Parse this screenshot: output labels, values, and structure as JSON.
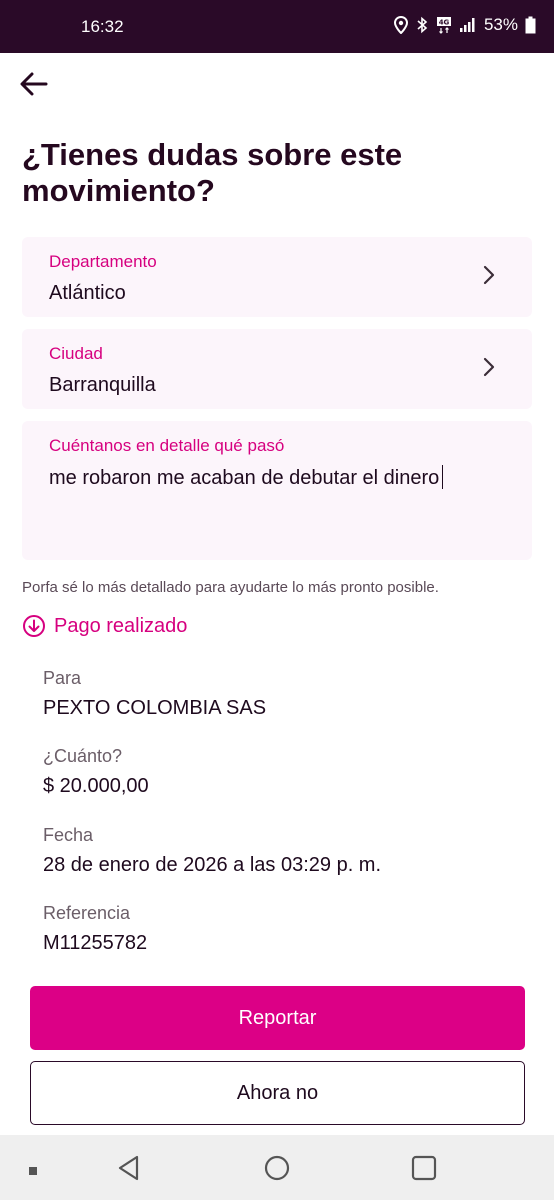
{
  "status_bar": {
    "time": "16:32",
    "battery": "53%",
    "icons": [
      "location-icon",
      "bluetooth-icon",
      "network-4g-icon",
      "signal-icon",
      "battery-icon"
    ]
  },
  "header": {
    "back_icon": "arrow-left-icon",
    "title": "¿Tienes dudas sobre este movimiento?"
  },
  "form": {
    "departamento": {
      "label": "Departamento",
      "value": "Atlántico"
    },
    "ciudad": {
      "label": "Ciudad",
      "value": "Barranquilla"
    },
    "detalle": {
      "label": "Cuéntanos en detalle qué pasó",
      "value": "me robaron me acaban de debutar el dinero"
    },
    "hint": "Porfa sé lo más detallado para ayudarte lo más pronto posible."
  },
  "pago": {
    "toggle_label": "Pago realizado",
    "para": {
      "label": "Para",
      "value": "PEXTO COLOMBIA SAS"
    },
    "cuanto": {
      "label": "¿Cuánto?",
      "value": "$ 20.000,00"
    },
    "fecha": {
      "label": "Fecha",
      "value": "28 de enero de 2026 a las 03:29 p. m."
    },
    "referencia": {
      "label": "Referencia",
      "value": "M11255782"
    }
  },
  "actions": {
    "primary": "Reportar",
    "secondary": "Ahora no"
  },
  "colors": {
    "accent": "#dc0086",
    "status_bar": "#2a0a28",
    "field_bg": "#fcf5fb"
  }
}
